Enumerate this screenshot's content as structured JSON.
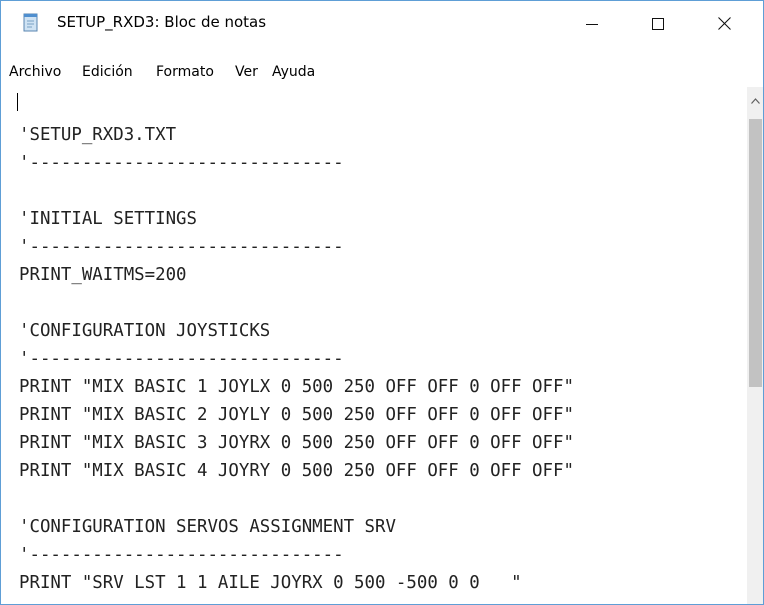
{
  "window": {
    "title": "SETUP_RXD3: Bloc de notas"
  },
  "menu": {
    "items": [
      "Archivo",
      "Edición",
      "Formato",
      "Ver",
      "Ayuda"
    ]
  },
  "editor": {
    "lines": [
      "",
      "'SETUP_RXD3.TXT",
      "'------------------------------",
      "",
      "'INITIAL SETTINGS",
      "'------------------------------",
      "PRINT_WAITMS=200",
      "",
      "'CONFIGURATION JOYSTICKS",
      "'------------------------------",
      "PRINT \"MIX BASIC 1 JOYLX 0 500 250 OFF OFF 0 OFF OFF\"",
      "PRINT \"MIX BASIC 2 JOYLY 0 500 250 OFF OFF 0 OFF OFF\"",
      "PRINT \"MIX BASIC 3 JOYRX 0 500 250 OFF OFF 0 OFF OFF\"",
      "PRINT \"MIX BASIC 4 JOYRY 0 500 250 OFF OFF 0 OFF OFF\"",
      "",
      "'CONFIGURATION SERVOS ASSIGNMENT SRV",
      "'------------------------------",
      "PRINT \"SRV LST 1 1 AILE JOYRX 0 500 -500 0 0   \""
    ]
  },
  "scrollbar": {
    "position_fraction": 0.0,
    "visible_fraction": 0.55
  },
  "colors": {
    "window_border": "#5e9ed6",
    "text": "#222222",
    "scroll_thumb": "#c2c2c2"
  },
  "icons": {
    "app": "notepad-icon",
    "minimize": "minimize-icon",
    "maximize": "maximize-icon",
    "close": "close-icon",
    "scroll_up": "chevron-up-icon"
  }
}
